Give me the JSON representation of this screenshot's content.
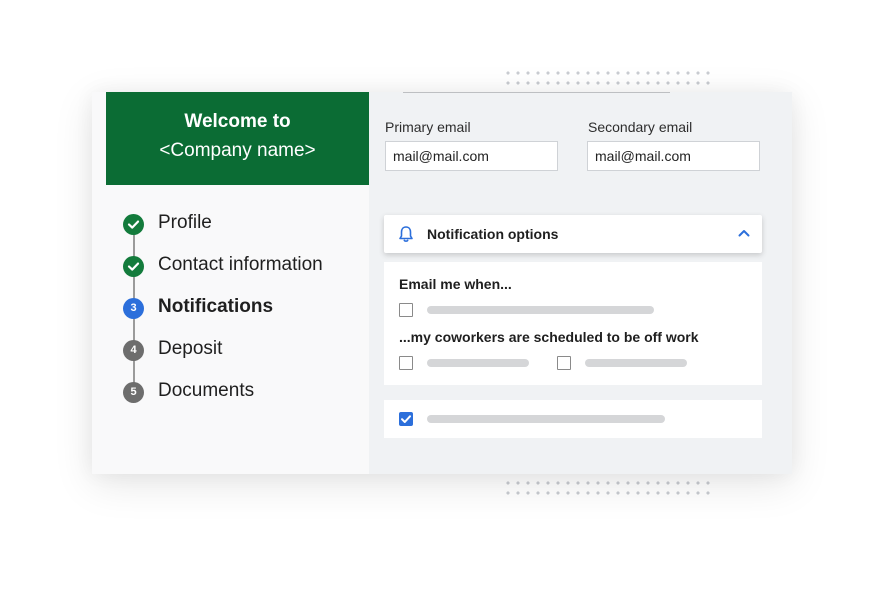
{
  "welcome": {
    "line1": "Welcome to",
    "line2": "<Company name>"
  },
  "steps": [
    {
      "label": "Profile",
      "status": "done",
      "number": ""
    },
    {
      "label": "Contact information",
      "status": "done",
      "number": ""
    },
    {
      "label": "Notifications",
      "status": "active",
      "number": "3"
    },
    {
      "label": "Deposit",
      "status": "pending",
      "number": "4"
    },
    {
      "label": "Documents",
      "status": "pending",
      "number": "5"
    }
  ],
  "form": {
    "primary_label": "Primary email",
    "primary_value": "mail@mail.com",
    "secondary_label": "Secondary email",
    "secondary_value": "mail@mail.com"
  },
  "notifications": {
    "section_title": "Notification options",
    "email_me_when": "Email me when...",
    "coworkers_text": "...my coworkers are scheduled to be off work",
    "bottom_checkbox_checked": true
  },
  "colors": {
    "brand_green": "#0b6c34",
    "accent_blue": "#2c6fdb",
    "done_green": "#137b3c"
  },
  "icons": [
    "check-icon",
    "bell-icon",
    "chevron-up-icon"
  ]
}
